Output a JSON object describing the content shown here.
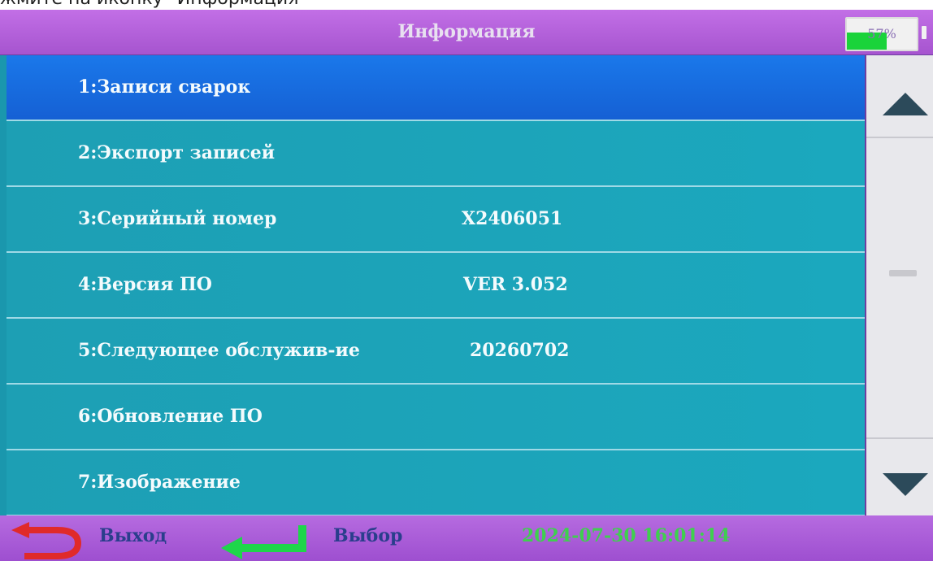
{
  "caption": "жмите на иконку \"Информация\"",
  "header": {
    "title": "Информация",
    "battery_text": "57%",
    "battery_level_percent": 57
  },
  "menu": {
    "items": [
      {
        "label": "1:Записи сварок",
        "value": ""
      },
      {
        "label": "2:Экспорт записей",
        "value": ""
      },
      {
        "label": "3:Серийный номер",
        "value": "X2406051"
      },
      {
        "label": "4:Версия ПО",
        "value": "VER 3.052"
      },
      {
        "label": "5:Следующее обслужив-ие",
        "value": "20260702"
      },
      {
        "label": "6:Обновление ПО",
        "value": ""
      },
      {
        "label": "7:Изображение",
        "value": ""
      }
    ]
  },
  "footer": {
    "exit_label": "Выход",
    "select_label": "Выбор",
    "datetime": "2024-07-30 16:01:14"
  },
  "colors": {
    "selected": "#1565da",
    "row": "#1ba3b9",
    "header": "#b562e0",
    "datetime": "#3fcf4f"
  },
  "icons": [
    "battery-icon",
    "scroll-up-arrow-icon",
    "scroll-down-arrow-icon",
    "back-arrow-icon",
    "enter-arrow-icon"
  ]
}
